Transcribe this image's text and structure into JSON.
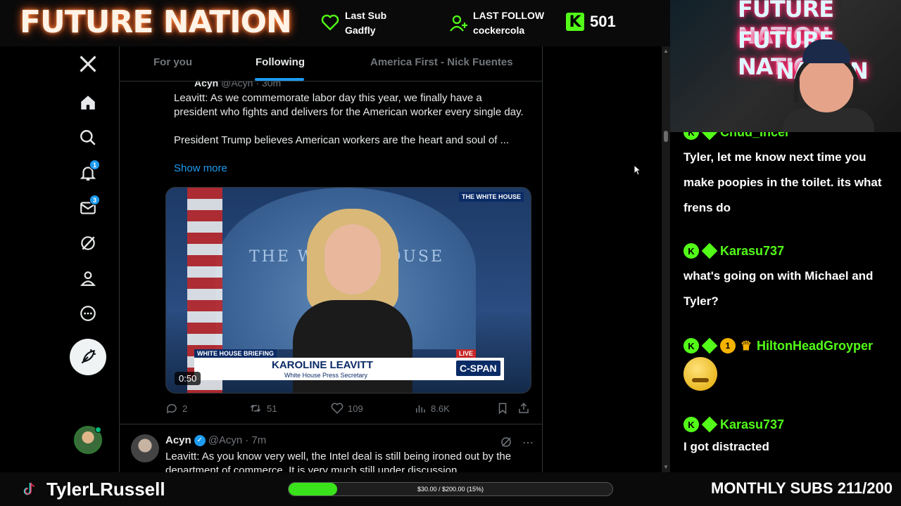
{
  "stream": {
    "brand_title": "FUTURE NATION",
    "last_sub_label": "Last Sub",
    "last_sub_name": "Gadfly",
    "last_follow_label": "LAST FOLLOW",
    "last_follow_name": "cockercola",
    "kick_viewers": "501",
    "webcam_neon_1": "FUTURE NATION",
    "webcam_neon_2": "FUTURE NATION",
    "webcam_neon_3": "NATION",
    "handle": "TylerLRussell",
    "goal_text": "$30.00 / $200.00 (15%)",
    "goal_progress": 0.15,
    "monthly_subs": "MONTHLY SUBS 211/200"
  },
  "nav": {
    "notifications_badge": "1",
    "messages_badge": "3"
  },
  "tabs": [
    {
      "label": "For you"
    },
    {
      "label": "Following"
    },
    {
      "label": "America First - Nick Fuentes"
    }
  ],
  "post1": {
    "header_cut": "Acyn",
    "header_meta": "@Acyn · 30m",
    "text_line1": "Leavitt: As we commemorate labor day this year, we finally have a president who fights and delivers for the American worker every single day.",
    "text_line2": "President Trump believes American workers are the heart and soul of ...",
    "show_more": "Show more",
    "media": {
      "corner_tag": "THE WHITE HOUSE",
      "backdrop_text": "THE WHITE HOUSE",
      "briefing_tag": "WHITE HOUSE BRIEFING",
      "name": "KAROLINE LEAVITT",
      "subtitle": "White House Press Secretary",
      "live_tag": "LIVE",
      "network": "C-SPAN",
      "bottom_text": "THE WHITE HOUSE",
      "duration": "0:50"
    },
    "replies": "2",
    "reposts": "51",
    "likes": "109",
    "views": "8.6K"
  },
  "post2": {
    "name": "Acyn",
    "handle": "@Acyn",
    "time": "· 7m",
    "text": "Leavitt: As you know very well, the Intel deal is still being ironed out by the department of commerce. It is very much still under discussion"
  },
  "chat": [
    {
      "user": "Chud_Incel",
      "text": "Tyler, let me know next time you make poopies in the toilet. its what frens do"
    },
    {
      "user": "Karasu737",
      "text": "what's going on with Michael and Tyler?"
    },
    {
      "user": "HiltonHeadGroyper",
      "text": "",
      "badge_num": "1"
    },
    {
      "user": "Karasu737",
      "text": "I got distracted"
    }
  ],
  "colors": {
    "kick_green": "#53fc18",
    "x_blue": "#1d9bf0"
  }
}
